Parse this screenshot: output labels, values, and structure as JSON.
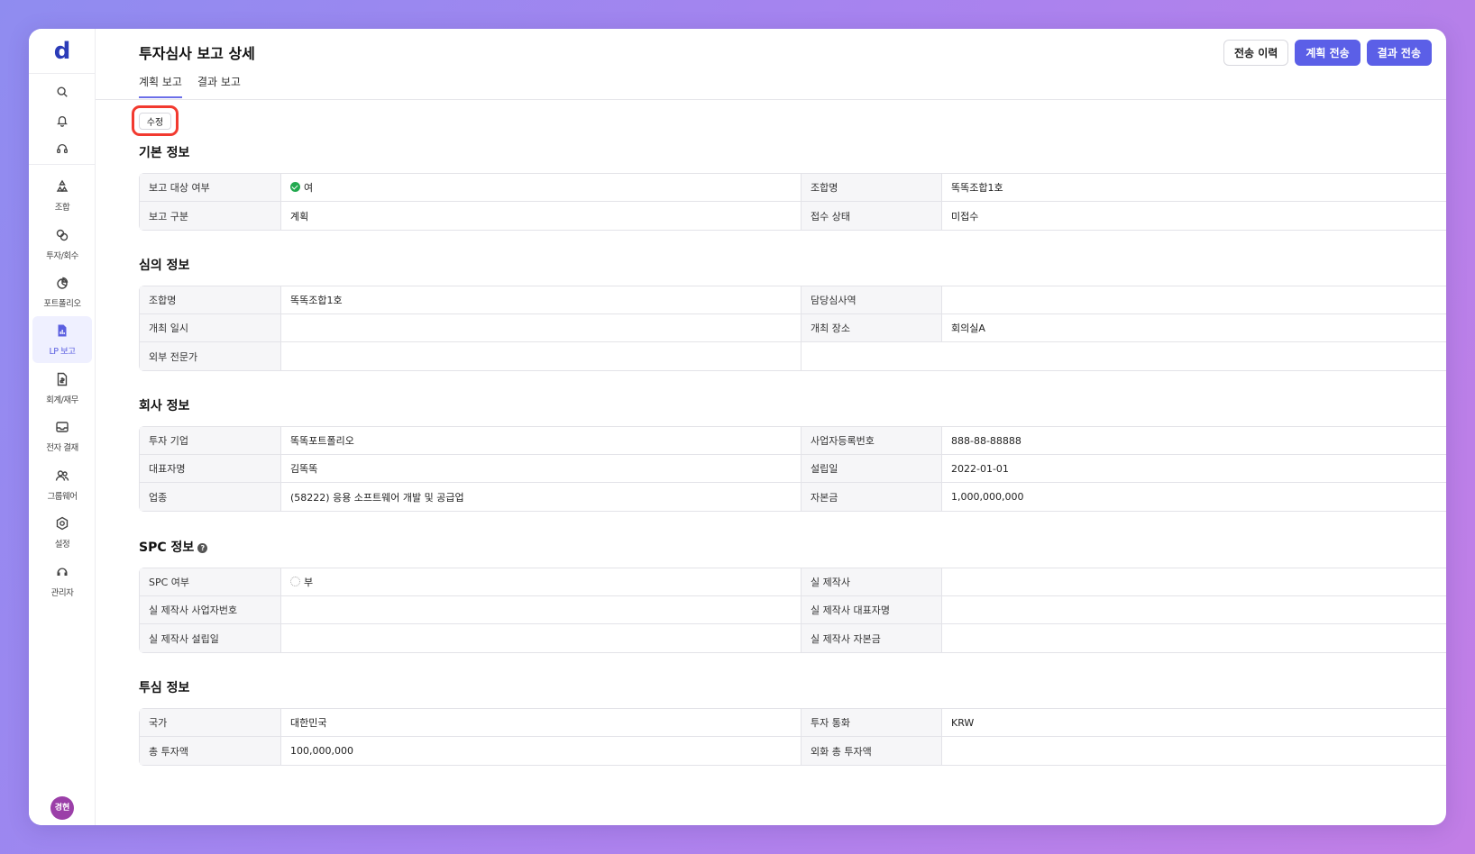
{
  "app": {
    "logo": "d",
    "user_initials": "경현"
  },
  "sidebar": {
    "top_icons": [
      "search-icon",
      "bell-icon",
      "headset-icon"
    ],
    "items": [
      {
        "label": "조합",
        "icon": "fund-icon"
      },
      {
        "label": "투자/회수",
        "icon": "investment-icon"
      },
      {
        "label": "포트폴리오",
        "icon": "portfolio-icon"
      },
      {
        "label": "LP 보고",
        "icon": "report-icon",
        "active": true
      },
      {
        "label": "회계/재무",
        "icon": "accounting-icon"
      },
      {
        "label": "전자 결재",
        "icon": "approval-icon"
      },
      {
        "label": "그룹웨어",
        "icon": "groupware-icon"
      },
      {
        "label": "설정",
        "icon": "gear-icon"
      },
      {
        "label": "관리자",
        "icon": "admin-icon"
      }
    ]
  },
  "header": {
    "title": "투자심사 보고 상세",
    "buttons": {
      "history": "전송 이력",
      "plan_send": "계획 전송",
      "result_send": "결과 전송"
    },
    "tabs": [
      "계획 보고",
      "결과 보고"
    ],
    "active_tab": "계획 보고"
  },
  "edit_label": "수정",
  "sections": {
    "basic": {
      "title": "기본 정보",
      "rows": [
        {
          "k1": "보고 대상 여부",
          "v1": "여",
          "k2": "조합명",
          "v2": "똑똑조합1호"
        },
        {
          "k1": "보고 구분",
          "v1": "계획",
          "k2": "접수 상태",
          "v2": "미접수"
        }
      ]
    },
    "review": {
      "title": "심의 정보",
      "rows": [
        {
          "k1": "조합명",
          "v1": "똑똑조합1호",
          "k2": "담당심사역",
          "v2": ""
        },
        {
          "k1": "개최 일시",
          "v1": "",
          "k2": "개최 장소",
          "v2": "회의실A"
        },
        {
          "k1": "외부 전문가",
          "v1": ""
        }
      ]
    },
    "company": {
      "title": "회사 정보",
      "rows": [
        {
          "k1": "투자 기업",
          "v1": "똑똑포트폴리오",
          "k2": "사업자등록번호",
          "v2": "888-88-88888"
        },
        {
          "k1": "대표자명",
          "v1": "김똑똑",
          "k2": "설립일",
          "v2": "2022-01-01"
        },
        {
          "k1": "업종",
          "v1": "(58222) 응용 소프트웨어 개발 및 공급업",
          "k2": "자본금",
          "v2": "1,000,000,000"
        }
      ]
    },
    "spc": {
      "title": "SPC 정보",
      "rows": [
        {
          "k1": "SPC 여부",
          "v1": "부",
          "k2": "실 제작사",
          "v2": ""
        },
        {
          "k1": "실 제작사 사업자번호",
          "v1": "",
          "k2": "실 제작사 대표자명",
          "v2": ""
        },
        {
          "k1": "실 제작사 설립일",
          "v1": "",
          "k2": "실 제작사 자본금",
          "v2": ""
        }
      ]
    },
    "invest": {
      "title": "투심 정보",
      "rows": [
        {
          "k1": "국가",
          "v1": "대한민국",
          "k2": "투자 통화",
          "v2": "KRW"
        },
        {
          "k1": "총 투자액",
          "v1": "100,000,000",
          "k2": "외화 총 투자액",
          "v2": ""
        }
      ]
    }
  }
}
